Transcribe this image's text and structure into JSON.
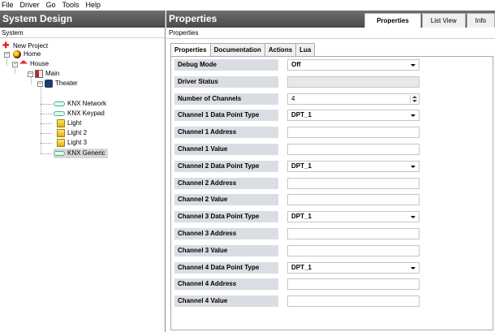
{
  "menu": [
    "File",
    "Driver",
    "Go",
    "Tools",
    "Help"
  ],
  "left": {
    "title": "System Design",
    "subtitle": "System",
    "tree": [
      {
        "label": "New Project",
        "icon": "project-icon"
      },
      {
        "label": "Home",
        "icon": "home-icon"
      },
      {
        "label": "House",
        "icon": "house-icon"
      },
      {
        "label": "Main",
        "icon": "room-icon"
      },
      {
        "label": "Theater",
        "icon": "theater-icon"
      },
      {
        "label": "KNX Network",
        "icon": "knx-icon"
      },
      {
        "label": "KNX Keypad",
        "icon": "knx-icon"
      },
      {
        "label": "Light",
        "icon": "light-icon"
      },
      {
        "label": "Light 2",
        "icon": "light-icon"
      },
      {
        "label": "Light 3",
        "icon": "light-icon"
      },
      {
        "label": "KNX Generic",
        "icon": "knx-icon"
      }
    ]
  },
  "right": {
    "title": "Properties",
    "tabs": [
      "Properties",
      "List View",
      "Info"
    ],
    "subtitle": "Properties",
    "subtabs": [
      "Properties",
      "Documentation",
      "Actions",
      "Lua"
    ],
    "properties": [
      {
        "label": "Debug Mode",
        "value": "Off",
        "kind": "select"
      },
      {
        "label": "Driver Status",
        "value": "",
        "kind": "disabled"
      },
      {
        "label": "Number of Channels",
        "value": "4",
        "kind": "spin"
      },
      {
        "label": "Channel 1 Data Point Type",
        "value": "DPT_1",
        "kind": "select"
      },
      {
        "label": "Channel 1 Address",
        "value": "",
        "kind": "text"
      },
      {
        "label": "Channel 1 Value",
        "value": "",
        "kind": "text"
      },
      {
        "label": "Channel 2 Data Point Type",
        "value": "DPT_1",
        "kind": "select"
      },
      {
        "label": "Channel 2 Address",
        "value": "",
        "kind": "text"
      },
      {
        "label": "Channel 2 Value",
        "value": "",
        "kind": "text"
      },
      {
        "label": "Channel 3 Data Point Type",
        "value": "DPT_1",
        "kind": "select"
      },
      {
        "label": "Channel 3 Address",
        "value": "",
        "kind": "text"
      },
      {
        "label": "Channel 3 Value",
        "value": "",
        "kind": "text"
      },
      {
        "label": "Channel 4 Data Point Type",
        "value": "DPT_1",
        "kind": "select"
      },
      {
        "label": "Channel 4 Address",
        "value": "",
        "kind": "text"
      },
      {
        "label": "Channel 4 Value",
        "value": "",
        "kind": "text"
      }
    ]
  }
}
